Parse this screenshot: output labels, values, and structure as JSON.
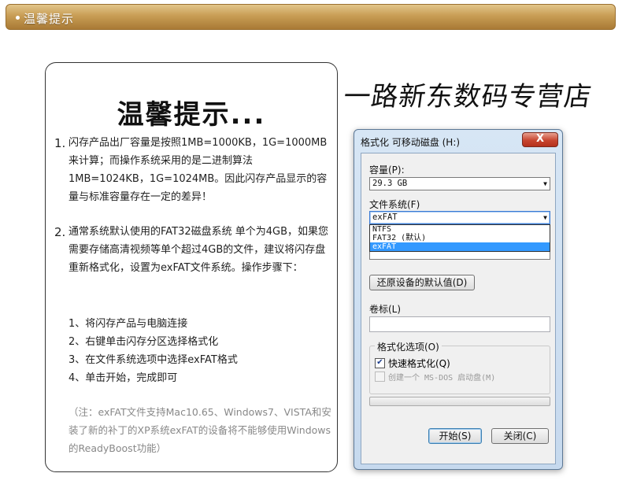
{
  "header": {
    "title": "温馨提示"
  },
  "notice": {
    "title": "温馨提示...",
    "items": [
      {
        "num": "1.",
        "text": "闪存产品出厂容量是按照1MB=1000KB，1G=1000MB来计算；而操作系统采用的是二进制算法1MB=1024KB，1G=1024MB。因此闪存产品显示的容量与标准容量存在一定的差异！"
      },
      {
        "num": "2.",
        "text": "通常系统默认使用的FAT32磁盘系统 单个为4GB，如果您需要存储高清视频等单个超过4GB的文件，建议将闪存盘重新格式化，设置为exFAT文件系统。操作步骤下："
      }
    ],
    "steps": [
      "1、将闪存产品与电脑连接",
      "2、右键单击闪存分区选择格式化",
      "3、在文件系统选项中选择exFAT格式",
      "4、单击开始，完成即可"
    ],
    "note": "（注：exFAT文件支持Mac10.65、Windows7、VISTA和安装了新的补丁的XP系统exFAT的设备将不能够使用Windows的ReadyBoost功能）"
  },
  "store_name": "一路新东数码专营店",
  "dialog": {
    "title": "格式化 可移动磁盘 (H:)",
    "close_label": "X",
    "capacity_label": "容量(P):",
    "capacity_value": "29.3 GB",
    "filesystem_label": "文件系统(F)",
    "filesystem_value": "exFAT",
    "filesystem_options": [
      "NTFS",
      "FAT32 (默认)",
      "exFAT"
    ],
    "restore_button": "还原设备的默认值(D)",
    "volume_label": "卷标(L)",
    "volume_value": "",
    "format_options_label": "格式化选项(O)",
    "quick_format_label": "快速格式化(Q)",
    "quick_format_checked": true,
    "msdos_label": "创建一个 MS-DOS 启动盘(M)",
    "msdos_checked": false,
    "progress": 0,
    "start_button": "开始(S)",
    "close_button": "关闭(C)"
  }
}
